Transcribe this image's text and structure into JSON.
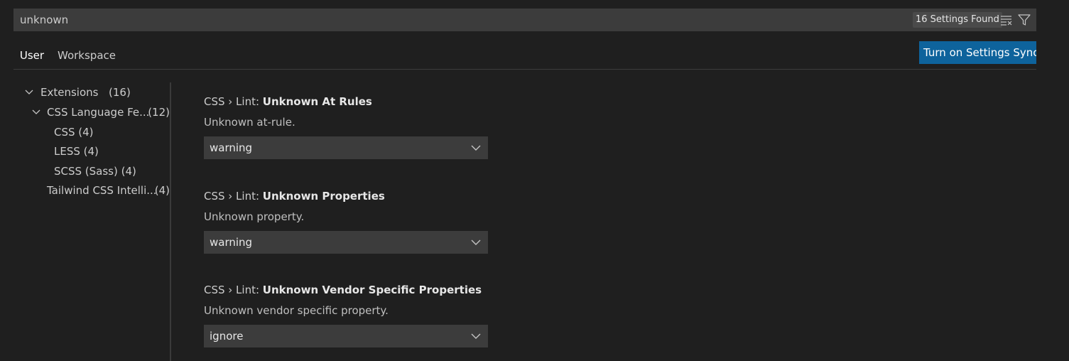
{
  "search": {
    "value": "unknown",
    "found_label": "16 Settings Found",
    "clear_icon": "clear-filter-icon",
    "filter_icon": "filter-icon"
  },
  "tabs": [
    {
      "label": "User",
      "active": true
    },
    {
      "label": "Workspace",
      "active": false
    }
  ],
  "sync_button": {
    "label": "Turn on Settings Sync",
    "color": "#0e639c"
  },
  "toc": {
    "items": [
      {
        "label": "Extensions",
        "count": "(16)",
        "expanded": true
      },
      {
        "label": "CSS Language Fe...",
        "count": "(12)",
        "expanded": true
      },
      {
        "label": "CSS (4)"
      },
      {
        "label": "LESS (4)"
      },
      {
        "label": "SCSS (Sass) (4)"
      },
      {
        "label": "Tailwind CSS Intelli...",
        "count": "(4)"
      }
    ]
  },
  "settings": [
    {
      "category": "CSS › Lint: ",
      "name": "Unknown At Rules",
      "description": "Unknown at-rule.",
      "value": "warning"
    },
    {
      "category": "CSS › Lint: ",
      "name": "Unknown Properties",
      "description": "Unknown property.",
      "value": "warning"
    },
    {
      "category": "CSS › Lint: ",
      "name": "Unknown Vendor Specific Properties",
      "description": "Unknown vendor specific property.",
      "value": "ignore"
    }
  ]
}
